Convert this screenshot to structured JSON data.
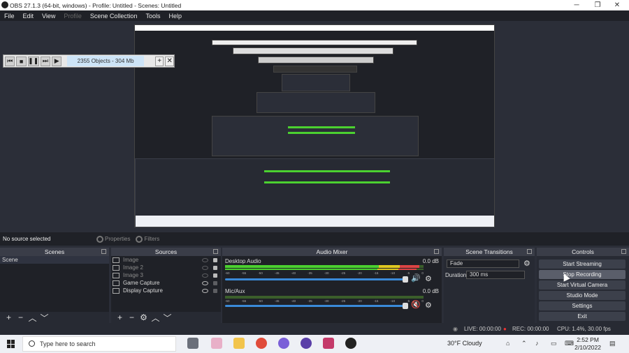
{
  "window": {
    "title": "OBS 27.1.3 (64-bit, windows) - Profile: Untitled - Scenes: Untitled",
    "minimize": "─",
    "maximize": "❐",
    "close": "✕"
  },
  "menu": [
    "File",
    "Edit",
    "View",
    "Profile",
    "Scene Collection",
    "Tools",
    "Help"
  ],
  "player": {
    "info": "2355 Objects - 304 Mb",
    "add": "+",
    "close": "✕"
  },
  "source_toolbar": {
    "no_source": "No source selected",
    "properties": "Properties",
    "filters": "Filters"
  },
  "scenes": {
    "header": "Scenes",
    "items": [
      "Scene"
    ],
    "footer": [
      "+",
      "−",
      "︿",
      "﹀"
    ]
  },
  "sources": {
    "header": "Sources",
    "items": [
      {
        "name": "Image",
        "visible": false
      },
      {
        "name": "Image 2",
        "visible": false
      },
      {
        "name": "Image 3",
        "visible": false
      },
      {
        "name": "Game Capture",
        "visible": true
      },
      {
        "name": "Display Capture",
        "visible": true
      }
    ],
    "footer": [
      "+",
      "−",
      "⚙",
      "︿",
      "﹀"
    ]
  },
  "mixer": {
    "header": "Audio Mixer",
    "channels": [
      {
        "name": "Desktop Audio",
        "db": "0.0 dB",
        "muted": false
      },
      {
        "name": "Mic/Aux",
        "db": "0.0 dB",
        "muted": true
      }
    ],
    "ticks": [
      "-60",
      "-55",
      "-50",
      "-45",
      "-40",
      "-35",
      "-30",
      "-25",
      "-20",
      "-15",
      "-10",
      "-5",
      "0"
    ]
  },
  "transitions": {
    "header": "Scene Transitions",
    "selected": "Fade",
    "duration_label": "Duration",
    "duration_value": "300 ms"
  },
  "controls": {
    "header": "Controls",
    "buttons": [
      "Start Streaming",
      "Stop Recording",
      "Start Virtual Camera",
      "Studio Mode",
      "Settings",
      "Exit"
    ]
  },
  "status": {
    "live": "LIVE: 00:00:00",
    "rec": "REC: 00:00:00",
    "cpu": "CPU: 1.4%, 30.00 fps"
  },
  "taskbar": {
    "search_placeholder": "Type here to search",
    "weather": "30°F  Cloudy",
    "time": "2:52 PM",
    "date": "2/10/2022"
  },
  "colors": {
    "accent_blue": "#3a8ad8",
    "meter_green": "#4bd130",
    "meter_yellow": "#e0c820",
    "meter_red": "#dd4444",
    "panel_bg": "#272a33"
  }
}
